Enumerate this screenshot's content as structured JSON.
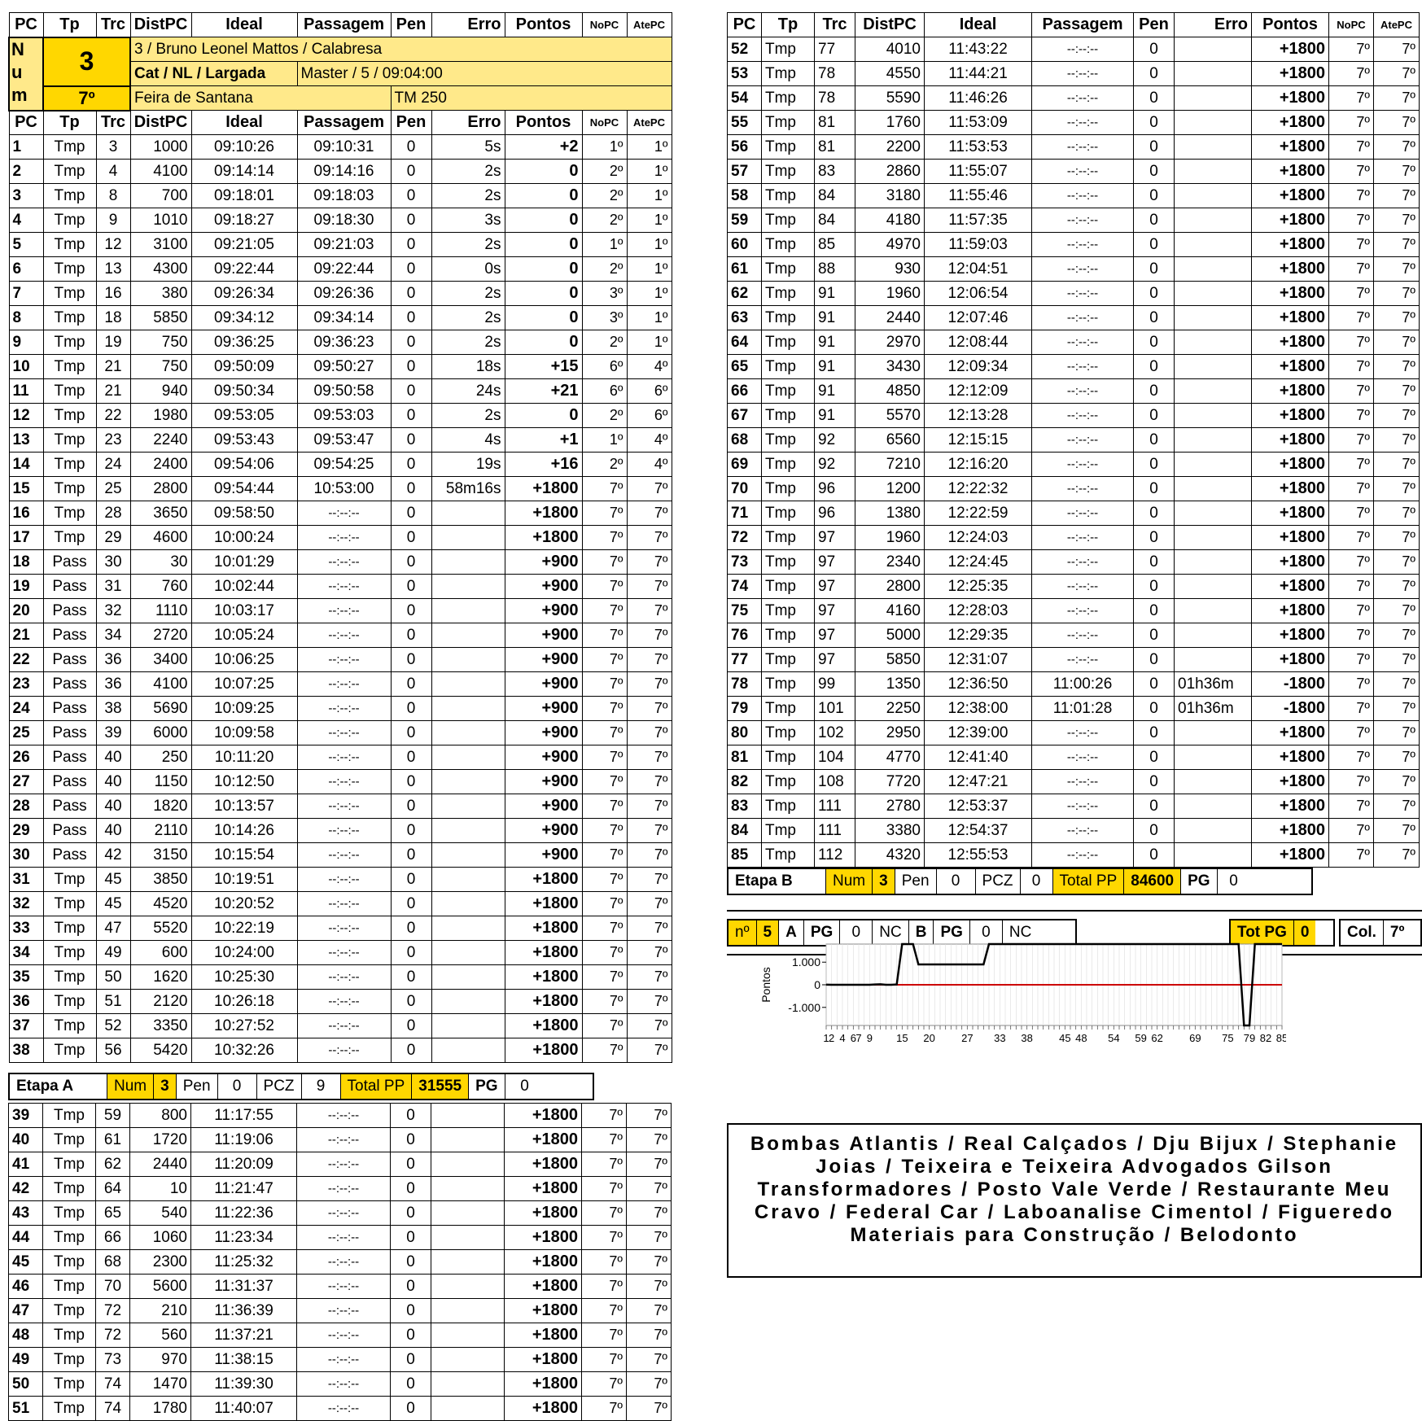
{
  "columns": [
    "PC",
    "Tp",
    "Trc",
    "DistPC",
    "Ideal",
    "Passagem",
    "Pen",
    "Erro",
    "Pontos",
    "NoPC",
    "AtePC"
  ],
  "competitor": {
    "num_label": "N u m",
    "num": "3",
    "position": "7º",
    "line1": "3 / Bruno Leonel Mattos / Calabresa",
    "line2_label": "Cat / NL / Largada",
    "line2_value": "Master / 5 / 09:04:00",
    "city": "Feira de Santana",
    "vehicle": "TM 250"
  },
  "rows_a": [
    [
      "1",
      "Tmp",
      "3",
      "1000",
      "09:10:26",
      "09:10:31",
      "0",
      "5s",
      "+2",
      "1º",
      "1º"
    ],
    [
      "2",
      "Tmp",
      "4",
      "4100",
      "09:14:14",
      "09:14:16",
      "0",
      "2s",
      "0",
      "2º",
      "1º"
    ],
    [
      "3",
      "Tmp",
      "8",
      "700",
      "09:18:01",
      "09:18:03",
      "0",
      "2s",
      "0",
      "2º",
      "1º"
    ],
    [
      "4",
      "Tmp",
      "9",
      "1010",
      "09:18:27",
      "09:18:30",
      "0",
      "3s",
      "0",
      "2º",
      "1º"
    ],
    [
      "5",
      "Tmp",
      "12",
      "3100",
      "09:21:05",
      "09:21:03",
      "0",
      "2s",
      "0",
      "1º",
      "1º"
    ],
    [
      "6",
      "Tmp",
      "13",
      "4300",
      "09:22:44",
      "09:22:44",
      "0",
      "0s",
      "0",
      "2º",
      "1º"
    ],
    [
      "7",
      "Tmp",
      "16",
      "380",
      "09:26:34",
      "09:26:36",
      "0",
      "2s",
      "0",
      "3º",
      "1º"
    ],
    [
      "8",
      "Tmp",
      "18",
      "5850",
      "09:34:12",
      "09:34:14",
      "0",
      "2s",
      "0",
      "3º",
      "1º"
    ],
    [
      "9",
      "Tmp",
      "19",
      "750",
      "09:36:25",
      "09:36:23",
      "0",
      "2s",
      "0",
      "2º",
      "1º"
    ],
    [
      "10",
      "Tmp",
      "21",
      "750",
      "09:50:09",
      "09:50:27",
      "0",
      "18s",
      "+15",
      "6º",
      "4º"
    ],
    [
      "11",
      "Tmp",
      "21",
      "940",
      "09:50:34",
      "09:50:58",
      "0",
      "24s",
      "+21",
      "6º",
      "6º"
    ],
    [
      "12",
      "Tmp",
      "22",
      "1980",
      "09:53:05",
      "09:53:03",
      "0",
      "2s",
      "0",
      "2º",
      "6º"
    ],
    [
      "13",
      "Tmp",
      "23",
      "2240",
      "09:53:43",
      "09:53:47",
      "0",
      "4s",
      "+1",
      "1º",
      "4º"
    ],
    [
      "14",
      "Tmp",
      "24",
      "2400",
      "09:54:06",
      "09:54:25",
      "0",
      "19s",
      "+16",
      "2º",
      "4º"
    ],
    [
      "15",
      "Tmp",
      "25",
      "2800",
      "09:54:44",
      "10:53:00",
      "0",
      "58m16s",
      "+1800",
      "7º",
      "7º"
    ],
    [
      "16",
      "Tmp",
      "28",
      "3650",
      "09:58:50",
      "--:--:--",
      "0",
      "",
      "+1800",
      "7º",
      "7º"
    ],
    [
      "17",
      "Tmp",
      "29",
      "4600",
      "10:00:24",
      "--:--:--",
      "0",
      "",
      "+1800",
      "7º",
      "7º"
    ],
    [
      "18",
      "Pass",
      "30",
      "30",
      "10:01:29",
      "--:--:--",
      "0",
      "",
      "+900",
      "7º",
      "7º"
    ],
    [
      "19",
      "Pass",
      "31",
      "760",
      "10:02:44",
      "--:--:--",
      "0",
      "",
      "+900",
      "7º",
      "7º"
    ],
    [
      "20",
      "Pass",
      "32",
      "1110",
      "10:03:17",
      "--:--:--",
      "0",
      "",
      "+900",
      "7º",
      "7º"
    ],
    [
      "21",
      "Pass",
      "34",
      "2720",
      "10:05:24",
      "--:--:--",
      "0",
      "",
      "+900",
      "7º",
      "7º"
    ],
    [
      "22",
      "Pass",
      "36",
      "3400",
      "10:06:25",
      "--:--:--",
      "0",
      "",
      "+900",
      "7º",
      "7º"
    ],
    [
      "23",
      "Pass",
      "36",
      "4100",
      "10:07:25",
      "--:--:--",
      "0",
      "",
      "+900",
      "7º",
      "7º"
    ],
    [
      "24",
      "Pass",
      "38",
      "5690",
      "10:09:25",
      "--:--:--",
      "0",
      "",
      "+900",
      "7º",
      "7º"
    ],
    [
      "25",
      "Pass",
      "39",
      "6000",
      "10:09:58",
      "--:--:--",
      "0",
      "",
      "+900",
      "7º",
      "7º"
    ],
    [
      "26",
      "Pass",
      "40",
      "250",
      "10:11:20",
      "--:--:--",
      "0",
      "",
      "+900",
      "7º",
      "7º"
    ],
    [
      "27",
      "Pass",
      "40",
      "1150",
      "10:12:50",
      "--:--:--",
      "0",
      "",
      "+900",
      "7º",
      "7º"
    ],
    [
      "28",
      "Pass",
      "40",
      "1820",
      "10:13:57",
      "--:--:--",
      "0",
      "",
      "+900",
      "7º",
      "7º"
    ],
    [
      "29",
      "Pass",
      "40",
      "2110",
      "10:14:26",
      "--:--:--",
      "0",
      "",
      "+900",
      "7º",
      "7º"
    ],
    [
      "30",
      "Pass",
      "42",
      "3150",
      "10:15:54",
      "--:--:--",
      "0",
      "",
      "+900",
      "7º",
      "7º"
    ],
    [
      "31",
      "Tmp",
      "45",
      "3850",
      "10:19:51",
      "--:--:--",
      "0",
      "",
      "+1800",
      "7º",
      "7º"
    ],
    [
      "32",
      "Tmp",
      "45",
      "4520",
      "10:20:52",
      "--:--:--",
      "0",
      "",
      "+1800",
      "7º",
      "7º"
    ],
    [
      "33",
      "Tmp",
      "47",
      "5520",
      "10:22:19",
      "--:--:--",
      "0",
      "",
      "+1800",
      "7º",
      "7º"
    ],
    [
      "34",
      "Tmp",
      "49",
      "600",
      "10:24:00",
      "--:--:--",
      "0",
      "",
      "+1800",
      "7º",
      "7º"
    ],
    [
      "35",
      "Tmp",
      "50",
      "1620",
      "10:25:30",
      "--:--:--",
      "0",
      "",
      "+1800",
      "7º",
      "7º"
    ],
    [
      "36",
      "Tmp",
      "51",
      "2120",
      "10:26:18",
      "--:--:--",
      "0",
      "",
      "+1800",
      "7º",
      "7º"
    ],
    [
      "37",
      "Tmp",
      "52",
      "3350",
      "10:27:52",
      "--:--:--",
      "0",
      "",
      "+1800",
      "7º",
      "7º"
    ],
    [
      "38",
      "Tmp",
      "56",
      "5420",
      "10:32:26",
      "--:--:--",
      "0",
      "",
      "+1800",
      "7º",
      "7º"
    ]
  ],
  "etapa_a": {
    "label": "Etapa A",
    "num_label": "Num",
    "num": "3",
    "pen_label": "Pen",
    "pen": "0",
    "pcz_label": "PCZ",
    "pcz": "9",
    "total_label": "Total PP",
    "total": "31555",
    "pg_label": "PG",
    "pg": "0"
  },
  "rows_a2": [
    [
      "39",
      "Tmp",
      "59",
      "800",
      "11:17:55",
      "--:--:--",
      "0",
      "",
      "+1800",
      "7º",
      "7º"
    ],
    [
      "40",
      "Tmp",
      "61",
      "1720",
      "11:19:06",
      "--:--:--",
      "0",
      "",
      "+1800",
      "7º",
      "7º"
    ],
    [
      "41",
      "Tmp",
      "62",
      "2440",
      "11:20:09",
      "--:--:--",
      "0",
      "",
      "+1800",
      "7º",
      "7º"
    ],
    [
      "42",
      "Tmp",
      "64",
      "10",
      "11:21:47",
      "--:--:--",
      "0",
      "",
      "+1800",
      "7º",
      "7º"
    ],
    [
      "43",
      "Tmp",
      "65",
      "540",
      "11:22:36",
      "--:--:--",
      "0",
      "",
      "+1800",
      "7º",
      "7º"
    ],
    [
      "44",
      "Tmp",
      "66",
      "1060",
      "11:23:34",
      "--:--:--",
      "0",
      "",
      "+1800",
      "7º",
      "7º"
    ],
    [
      "45",
      "Tmp",
      "68",
      "2300",
      "11:25:32",
      "--:--:--",
      "0",
      "",
      "+1800",
      "7º",
      "7º"
    ],
    [
      "46",
      "Tmp",
      "70",
      "5600",
      "11:31:37",
      "--:--:--",
      "0",
      "",
      "+1800",
      "7º",
      "7º"
    ],
    [
      "47",
      "Tmp",
      "72",
      "210",
      "11:36:39",
      "--:--:--",
      "0",
      "",
      "+1800",
      "7º",
      "7º"
    ],
    [
      "48",
      "Tmp",
      "72",
      "560",
      "11:37:21",
      "--:--:--",
      "0",
      "",
      "+1800",
      "7º",
      "7º"
    ],
    [
      "49",
      "Tmp",
      "73",
      "970",
      "11:38:15",
      "--:--:--",
      "0",
      "",
      "+1800",
      "7º",
      "7º"
    ],
    [
      "50",
      "Tmp",
      "74",
      "1470",
      "11:39:30",
      "--:--:--",
      "0",
      "",
      "+1800",
      "7º",
      "7º"
    ],
    [
      "51",
      "Tmp",
      "74",
      "1780",
      "11:40:07",
      "--:--:--",
      "0",
      "",
      "+1800",
      "7º",
      "7º"
    ]
  ],
  "rows_b": [
    [
      "52",
      "Tmp",
      "77",
      "4010",
      "11:43:22",
      "--:--:--",
      "0",
      "",
      "+1800",
      "7º",
      "7º"
    ],
    [
      "53",
      "Tmp",
      "78",
      "4550",
      "11:44:21",
      "--:--:--",
      "0",
      "",
      "+1800",
      "7º",
      "7º"
    ],
    [
      "54",
      "Tmp",
      "78",
      "5590",
      "11:46:26",
      "--:--:--",
      "0",
      "",
      "+1800",
      "7º",
      "7º"
    ],
    [
      "55",
      "Tmp",
      "81",
      "1760",
      "11:53:09",
      "--:--:--",
      "0",
      "",
      "+1800",
      "7º",
      "7º"
    ],
    [
      "56",
      "Tmp",
      "81",
      "2200",
      "11:53:53",
      "--:--:--",
      "0",
      "",
      "+1800",
      "7º",
      "7º"
    ],
    [
      "57",
      "Tmp",
      "83",
      "2860",
      "11:55:07",
      "--:--:--",
      "0",
      "",
      "+1800",
      "7º",
      "7º"
    ],
    [
      "58",
      "Tmp",
      "84",
      "3180",
      "11:55:46",
      "--:--:--",
      "0",
      "",
      "+1800",
      "7º",
      "7º"
    ],
    [
      "59",
      "Tmp",
      "84",
      "4180",
      "11:57:35",
      "--:--:--",
      "0",
      "",
      "+1800",
      "7º",
      "7º"
    ],
    [
      "60",
      "Tmp",
      "85",
      "4970",
      "11:59:03",
      "--:--:--",
      "0",
      "",
      "+1800",
      "7º",
      "7º"
    ],
    [
      "61",
      "Tmp",
      "88",
      "930",
      "12:04:51",
      "--:--:--",
      "0",
      "",
      "+1800",
      "7º",
      "7º"
    ],
    [
      "62",
      "Tmp",
      "91",
      "1960",
      "12:06:54",
      "--:--:--",
      "0",
      "",
      "+1800",
      "7º",
      "7º"
    ],
    [
      "63",
      "Tmp",
      "91",
      "2440",
      "12:07:46",
      "--:--:--",
      "0",
      "",
      "+1800",
      "7º",
      "7º"
    ],
    [
      "64",
      "Tmp",
      "91",
      "2970",
      "12:08:44",
      "--:--:--",
      "0",
      "",
      "+1800",
      "7º",
      "7º"
    ],
    [
      "65",
      "Tmp",
      "91",
      "3430",
      "12:09:34",
      "--:--:--",
      "0",
      "",
      "+1800",
      "7º",
      "7º"
    ],
    [
      "66",
      "Tmp",
      "91",
      "4850",
      "12:12:09",
      "--:--:--",
      "0",
      "",
      "+1800",
      "7º",
      "7º"
    ],
    [
      "67",
      "Tmp",
      "91",
      "5570",
      "12:13:28",
      "--:--:--",
      "0",
      "",
      "+1800",
      "7º",
      "7º"
    ],
    [
      "68",
      "Tmp",
      "92",
      "6560",
      "12:15:15",
      "--:--:--",
      "0",
      "",
      "+1800",
      "7º",
      "7º"
    ],
    [
      "69",
      "Tmp",
      "92",
      "7210",
      "12:16:20",
      "--:--:--",
      "0",
      "",
      "+1800",
      "7º",
      "7º"
    ],
    [
      "70",
      "Tmp",
      "96",
      "1200",
      "12:22:32",
      "--:--:--",
      "0",
      "",
      "+1800",
      "7º",
      "7º"
    ],
    [
      "71",
      "Tmp",
      "96",
      "1380",
      "12:22:59",
      "--:--:--",
      "0",
      "",
      "+1800",
      "7º",
      "7º"
    ],
    [
      "72",
      "Tmp",
      "97",
      "1960",
      "12:24:03",
      "--:--:--",
      "0",
      "",
      "+1800",
      "7º",
      "7º"
    ],
    [
      "73",
      "Tmp",
      "97",
      "2340",
      "12:24:45",
      "--:--:--",
      "0",
      "",
      "+1800",
      "7º",
      "7º"
    ],
    [
      "74",
      "Tmp",
      "97",
      "2800",
      "12:25:35",
      "--:--:--",
      "0",
      "",
      "+1800",
      "7º",
      "7º"
    ],
    [
      "75",
      "Tmp",
      "97",
      "4160",
      "12:28:03",
      "--:--:--",
      "0",
      "",
      "+1800",
      "7º",
      "7º"
    ],
    [
      "76",
      "Tmp",
      "97",
      "5000",
      "12:29:35",
      "--:--:--",
      "0",
      "",
      "+1800",
      "7º",
      "7º"
    ],
    [
      "77",
      "Tmp",
      "97",
      "5850",
      "12:31:07",
      "--:--:--",
      "0",
      "",
      "+1800",
      "7º",
      "7º"
    ],
    [
      "78",
      "Tmp",
      "99",
      "1350",
      "12:36:50",
      "11:00:26",
      "0",
      "01h36m",
      "-1800",
      "7º",
      "7º"
    ],
    [
      "79",
      "Tmp",
      "101",
      "2250",
      "12:38:00",
      "11:01:28",
      "0",
      "01h36m",
      "-1800",
      "7º",
      "7º"
    ],
    [
      "80",
      "Tmp",
      "102",
      "2950",
      "12:39:00",
      "--:--:--",
      "0",
      "",
      "+1800",
      "7º",
      "7º"
    ],
    [
      "81",
      "Tmp",
      "104",
      "4770",
      "12:41:40",
      "--:--:--",
      "0",
      "",
      "+1800",
      "7º",
      "7º"
    ],
    [
      "82",
      "Tmp",
      "108",
      "7720",
      "12:47:21",
      "--:--:--",
      "0",
      "",
      "+1800",
      "7º",
      "7º"
    ],
    [
      "83",
      "Tmp",
      "111",
      "2780",
      "12:53:37",
      "--:--:--",
      "0",
      "",
      "+1800",
      "7º",
      "7º"
    ],
    [
      "84",
      "Tmp",
      "111",
      "3380",
      "12:54:37",
      "--:--:--",
      "0",
      "",
      "+1800",
      "7º",
      "7º"
    ],
    [
      "85",
      "Tmp",
      "112",
      "4320",
      "12:55:53",
      "--:--:--",
      "0",
      "",
      "+1800",
      "7º",
      "7º"
    ]
  ],
  "etapa_b": {
    "label": "Etapa B",
    "num_label": "Num",
    "num": "3",
    "pen_label": "Pen",
    "pen": "0",
    "pcz_label": "PCZ",
    "pcz": "0",
    "total_label": "Total PP",
    "total": "84600",
    "pg_label": "PG",
    "pg": "0"
  },
  "summary": {
    "n_label": "nº",
    "n": "5",
    "a_label": "A",
    "a_pg_label": "PG",
    "a_pg": "0",
    "a_nc": "NC",
    "b_label": "B",
    "b_pg_label": "PG",
    "b_pg": "0",
    "b_nc": "NC",
    "totpg_label": "Tot PG",
    "totpg": "0",
    "col_label": "Col.",
    "col": "7º"
  },
  "sponsors": "Bombas Atlantis / Real Calçados / Dju Bijux / Stephanie Joias / Teixeira e Teixeira Advogados Gilson Transformadores / Posto Vale Verde / Restaurante Meu Cravo / Federal Car / Laboanalise Cimentol / Figueredo Materiais para Construção / Belodonto",
  "chart_data": {
    "type": "line",
    "ylabel": "Pontos",
    "yticks": [
      "1.000",
      "0",
      "-1.000"
    ],
    "ylim": [
      -1800,
      1800
    ],
    "xlim": [
      1,
      85
    ],
    "xtick_labels": [
      "1",
      "2",
      "4",
      "6",
      "7",
      "9",
      "15",
      "20",
      "27",
      "33",
      "38",
      "45",
      "48",
      "54",
      "59",
      "62",
      "69",
      "75",
      "79",
      "82",
      "85"
    ],
    "series": [
      {
        "values": [
          2,
          0,
          0,
          0,
          0,
          0,
          0,
          0,
          0,
          15,
          21,
          0,
          1,
          16,
          1800,
          1800,
          1800,
          900,
          900,
          900,
          900,
          900,
          900,
          900,
          900,
          900,
          900,
          900,
          900,
          900,
          1800,
          1800,
          1800,
          1800,
          1800,
          1800,
          1800,
          1800,
          1800,
          1800,
          1800,
          1800,
          1800,
          1800,
          1800,
          1800,
          1800,
          1800,
          1800,
          1800,
          1800,
          1800,
          1800,
          1800,
          1800,
          1800,
          1800,
          1800,
          1800,
          1800,
          1800,
          1800,
          1800,
          1800,
          1800,
          1800,
          1800,
          1800,
          1800,
          1800,
          1800,
          1800,
          1800,
          1800,
          1800,
          1800,
          1800,
          -1800,
          -1800,
          1800,
          1800,
          1800,
          1800,
          1800,
          1800
        ]
      }
    ],
    "zero_line_color": "#cc0000"
  }
}
